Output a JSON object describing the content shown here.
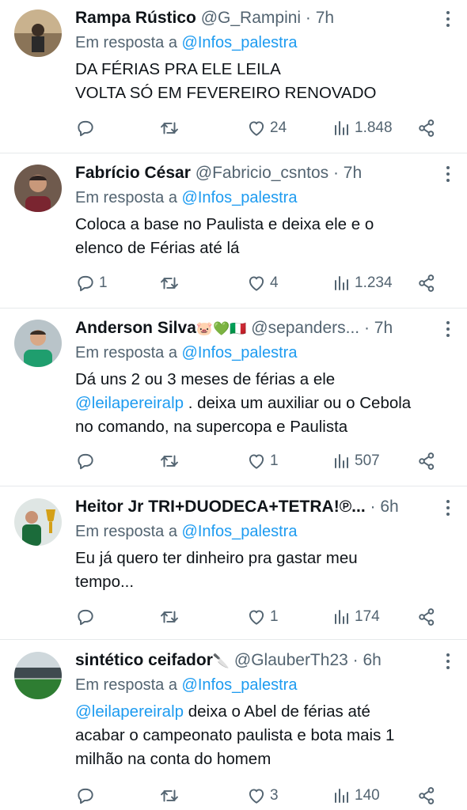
{
  "reply_prefix": "Em resposta a",
  "tweets": [
    {
      "name": "Rampa Rústico",
      "name_emoji": "",
      "handle": "@G_Rampini",
      "time": "· 7h",
      "reply_to": "@Infos_palestra",
      "mention": "",
      "text_lines": [
        "DA FÉRIAS PRA ELE LEILA",
        "VOLTA SÓ EM FEVEREIRO RENOVADO"
      ],
      "replies": "",
      "retweets": "",
      "likes": "24",
      "views": "1.848"
    },
    {
      "name": "Fabrício César",
      "name_emoji": "",
      "handle": "@Fabricio_csntos",
      "time": "· 7h",
      "reply_to": "@Infos_palestra",
      "mention": "",
      "text_lines": [
        "Coloca a base no Paulista e deixa ele e o",
        "elenco de Férias até lá"
      ],
      "replies": "1",
      "retweets": "",
      "likes": "4",
      "views": "1.234"
    },
    {
      "name": "Anderson Silva",
      "name_emoji": "🐷💚🇮🇹",
      "handle": "@sepanders...",
      "time": "· 7h",
      "reply_to": "@Infos_palestra",
      "mention": "@leilapereiralp",
      "text_lines": [
        "Dá uns 2 ou 3 meses de férias a ele",
        " . deixa um auxiliar ou o Cebola",
        "no comando, na supercopa e Paulista"
      ],
      "replies": "",
      "retweets": "",
      "likes": "1",
      "views": "507"
    },
    {
      "name": "Heitor Jr TRI+DUODECA+TETRA!℗...",
      "name_emoji": "",
      "handle": "",
      "time": "· 6h",
      "reply_to": "@Infos_palestra",
      "mention": "",
      "text_lines": [
        "Eu já quero ter dinheiro pra gastar meu",
        "tempo..."
      ],
      "replies": "",
      "retweets": "",
      "likes": "1",
      "views": "174"
    },
    {
      "name": "sintético ceifador",
      "name_emoji": "🔪",
      "handle": "@GlauberTh23",
      "time": "· 6h",
      "reply_to": "@Infos_palestra",
      "mention": "@leilapereiralp",
      "text_lines": [
        " deixa o Abel de férias até",
        "acabar o campeonato paulista e bota mais 1",
        "milhão na conta do homem"
      ],
      "replies": "",
      "retweets": "",
      "likes": "3",
      "views": "140"
    }
  ],
  "colors": {
    "text": "#0f1419",
    "secondary": "#536471",
    "link": "#1d9bf0",
    "divider": "#e6e9eb"
  },
  "icons": [
    "reply-icon",
    "retweet-icon",
    "like-icon",
    "views-icon",
    "share-icon",
    "more-icon"
  ]
}
